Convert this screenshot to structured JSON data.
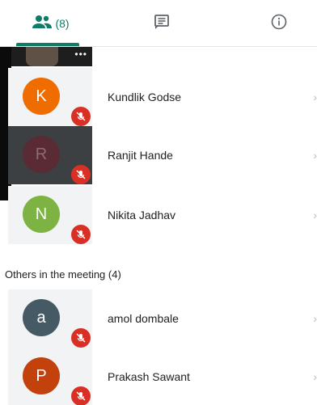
{
  "tabs": {
    "people_count": "(8)"
  },
  "sections": {
    "others_label": "Others in the meeting (4)"
  },
  "participants_top": [
    {
      "initial": "K",
      "name": "Kundlik Godse",
      "color": "#ef6c00"
    },
    {
      "initial": "R",
      "name": "Ranjit Hande",
      "color": "#5a2a35"
    },
    {
      "initial": "N",
      "name": "Nikita Jadhav",
      "color": "#7cb342"
    }
  ],
  "participants_others": [
    {
      "initial": "a",
      "name": "amol dombale",
      "color": "#455a64"
    },
    {
      "initial": "P",
      "name": "Prakash Sawant",
      "color": "#c2410c"
    }
  ],
  "video_tile_menu": "•••"
}
